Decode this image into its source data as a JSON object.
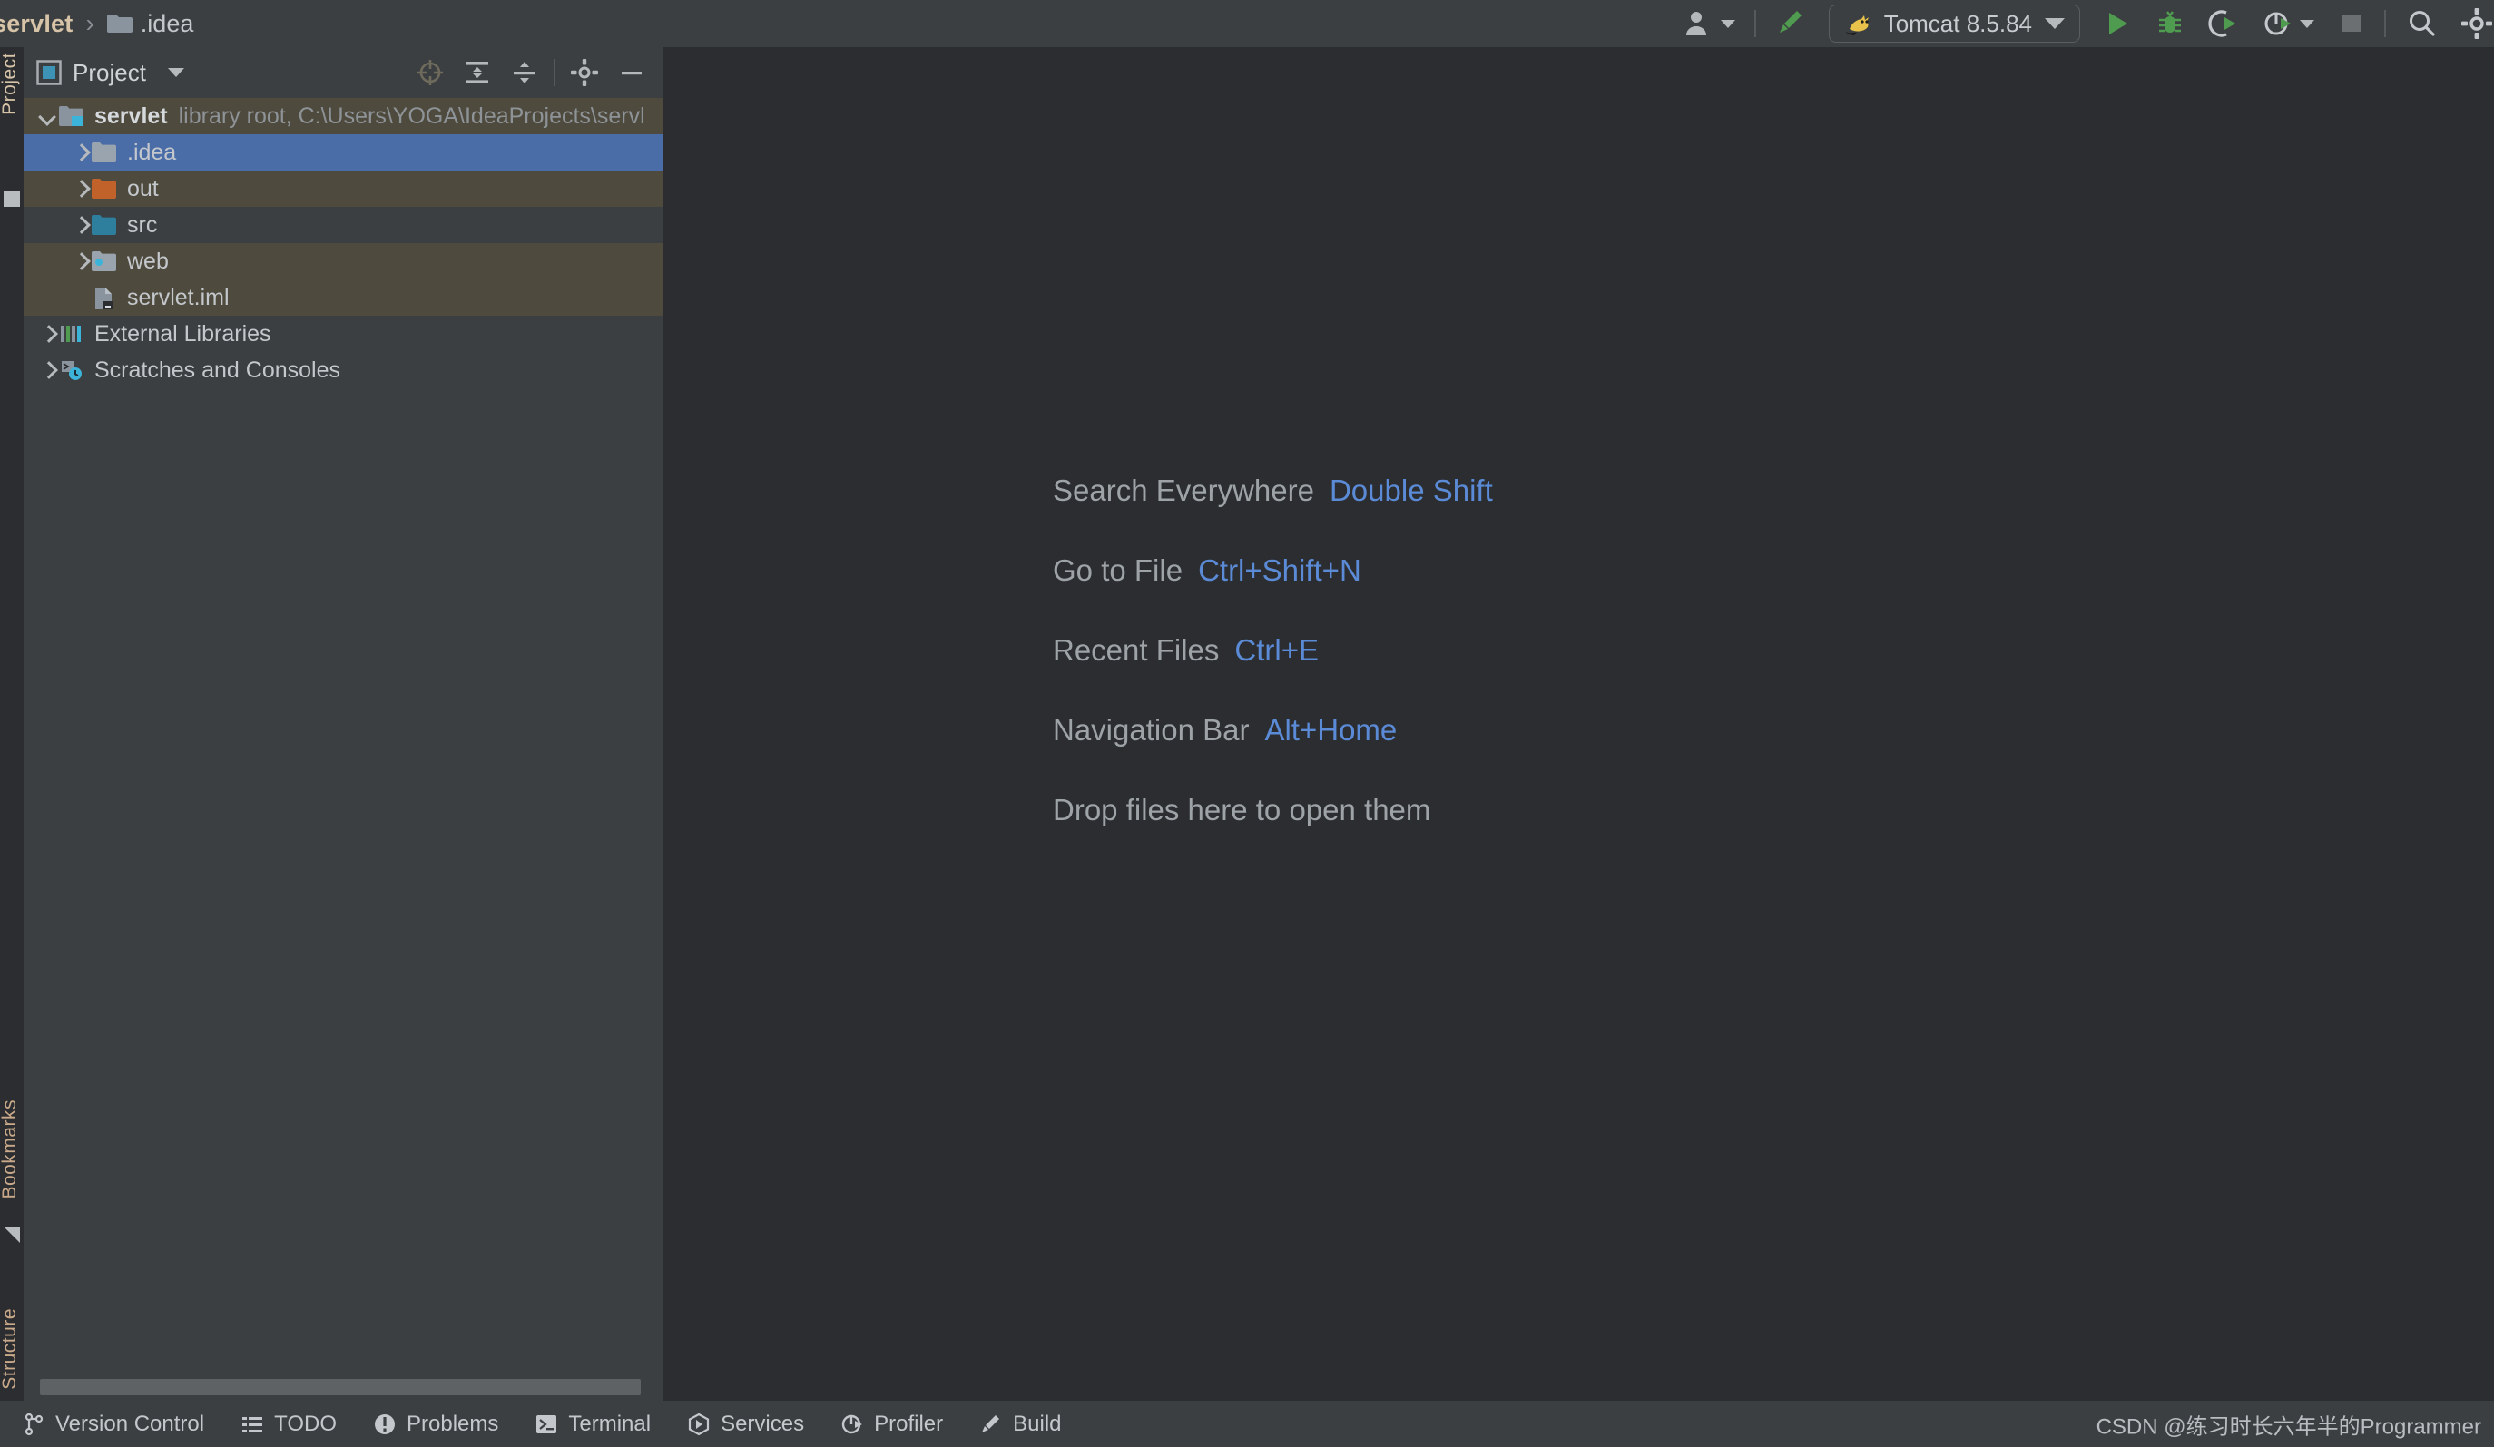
{
  "window": {
    "theme_bg": "#2b2d30",
    "panel_bg": "#3c3f41",
    "accent_blue": "#4a6da7",
    "link_blue": "#5b8bd6",
    "tint_olive": "#4e4a3d"
  },
  "breadcrumb": {
    "project": "servlet",
    "separator": "›",
    "current": ".idea",
    "folder_icon": "folder-icon"
  },
  "toolbar": {
    "items": [
      {
        "name": "user-account-button",
        "icon": "user-icon",
        "has_caret": true
      },
      {
        "name": "build-project-button",
        "icon": "hammer-icon",
        "has_caret": false
      }
    ],
    "run_config": {
      "label": "Tomcat 8.5.84",
      "icon": "tomcat-cat-icon",
      "caret": "chevron-down-icon"
    },
    "run_label": "Run",
    "debug_label": "Debug",
    "run_coverage_label": "Run with Coverage",
    "profile_label": "Profile",
    "stop_label": "Stop",
    "search_label": "Search",
    "settings_label": "Settings"
  },
  "rail": {
    "project_label": "Project",
    "bookmarks_label": "Bookmarks",
    "structure_label": "Structure"
  },
  "project_panel": {
    "title": "Project",
    "caret": "chevron-down-icon",
    "tools": [
      {
        "name": "select-opened-file-button",
        "icon": "crosshair-icon"
      },
      {
        "name": "expand-all-button",
        "icon": "expand-all-icon"
      },
      {
        "name": "collapse-all-button",
        "icon": "collapse-all-icon"
      },
      {
        "name": "panel-settings-button",
        "icon": "gear-icon"
      },
      {
        "name": "hide-panel-button",
        "icon": "minimize-icon"
      }
    ],
    "tree": [
      {
        "label": "servlet",
        "detail": "library root,  C:\\Users\\YOGA\\IdeaProjects\\servl",
        "icon": "module-icon",
        "arrow": "expanded",
        "indent": 0,
        "bold": true,
        "state": "tint-olive"
      },
      {
        "label": ".idea",
        "detail": "",
        "icon": "folder-gray-icon",
        "arrow": "collapsed",
        "indent": 1,
        "bold": false,
        "state": "sel"
      },
      {
        "label": "out",
        "detail": "",
        "icon": "folder-orange-icon",
        "arrow": "collapsed",
        "indent": 1,
        "bold": false,
        "state": "tint-olive"
      },
      {
        "label": "src",
        "detail": "",
        "icon": "folder-blue-icon",
        "arrow": "collapsed",
        "indent": 1,
        "bold": false,
        "state": "tint-dark"
      },
      {
        "label": "web",
        "detail": "",
        "icon": "folder-web-icon",
        "arrow": "collapsed",
        "indent": 1,
        "bold": false,
        "state": "tint-olive"
      },
      {
        "label": "servlet.iml",
        "detail": "",
        "icon": "iml-file-icon",
        "arrow": "none",
        "indent": 1,
        "bold": false,
        "state": "tint-olive"
      },
      {
        "label": "External Libraries",
        "detail": "",
        "icon": "libraries-icon",
        "arrow": "collapsed",
        "indent": 0,
        "bold": false,
        "state": "tint-dark"
      },
      {
        "label": "Scratches and Consoles",
        "detail": "",
        "icon": "scratches-icon",
        "arrow": "collapsed",
        "indent": 0,
        "bold": false,
        "state": "tint-dark"
      }
    ]
  },
  "editor": {
    "hints": [
      {
        "label": "Search Everywhere",
        "key": "Double Shift"
      },
      {
        "label": "Go to File",
        "key": "Ctrl+Shift+N"
      },
      {
        "label": "Recent Files",
        "key": "Ctrl+E"
      },
      {
        "label": "Navigation Bar",
        "key": "Alt+Home"
      },
      {
        "label": "Drop files here to open them",
        "key": ""
      }
    ]
  },
  "status_bar": {
    "items": [
      {
        "label": "Version Control",
        "icon": "branch-icon"
      },
      {
        "label": "TODO",
        "icon": "list-icon"
      },
      {
        "label": "Problems",
        "icon": "warning-icon"
      },
      {
        "label": "Terminal",
        "icon": "terminal-icon"
      },
      {
        "label": "Services",
        "icon": "services-icon"
      },
      {
        "label": "Profiler",
        "icon": "profiler-icon"
      },
      {
        "label": "Build",
        "icon": "hammer-icon"
      }
    ],
    "watermark": "CSDN @练习时长六年半的Programmer"
  }
}
